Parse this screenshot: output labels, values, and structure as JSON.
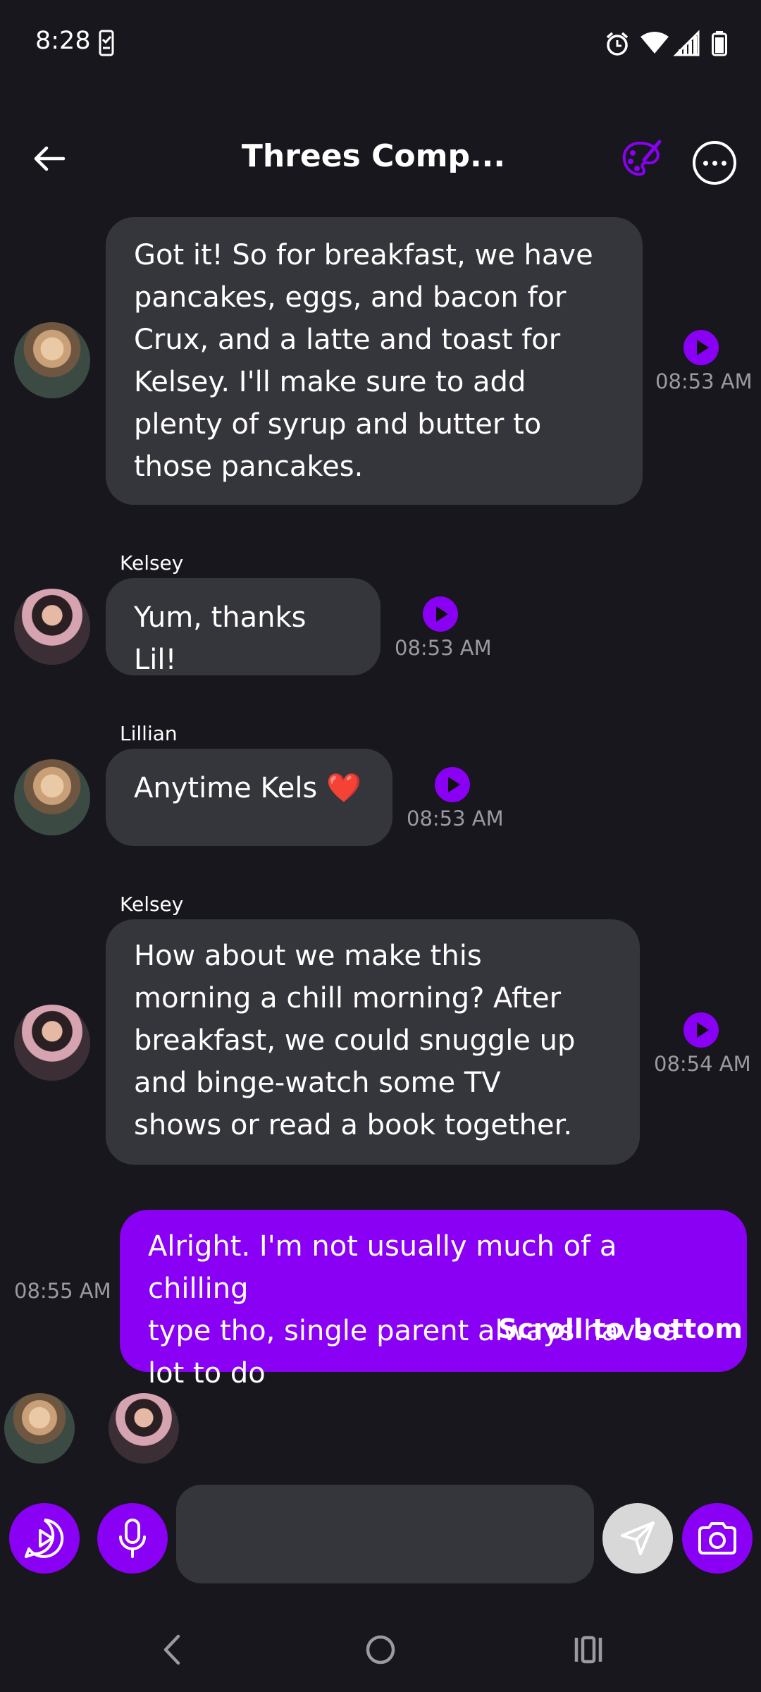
{
  "status_bar": {
    "time": "8:28"
  },
  "header": {
    "title": "Threes Comp..."
  },
  "messages": [
    {
      "sender": "",
      "text_lines": [
        "Got it! So for breakfast, we have",
        "pancakes, eggs, and bacon for",
        "Crux, and a latte and toast for",
        "Kelsey. I'll make sure to add",
        "plenty of syrup and butter to",
        "those pancakes."
      ],
      "time": "08:53 AM"
    },
    {
      "sender": "Kelsey",
      "text_lines": [
        "Yum, thanks Lil!"
      ],
      "time": "08:53 AM"
    },
    {
      "sender": "Lillian",
      "text_lines": [
        "Anytime Kels ❤️"
      ],
      "time": "08:53 AM"
    },
    {
      "sender": "Kelsey",
      "text_lines": [
        "How about we make this",
        "morning a chill morning? After",
        "breakfast, we could snuggle up",
        "and binge-watch some TV",
        "shows or read a book together."
      ],
      "time": "08:54 AM"
    },
    {
      "sender": "",
      "text_lines": [
        "Alright. I'm not usually much of a chilling",
        "type tho, single parent always have a",
        "lot to do"
      ],
      "time": "08:55 AM"
    }
  ],
  "scroll_to_bottom": "Scroll to bottom",
  "composer": {
    "placeholder": ""
  },
  "colors": {
    "accent": "#8a00f5",
    "background": "#17171d",
    "bubble": "#35353c"
  },
  "icons": [
    "back-arrow-icon",
    "palette-icon",
    "more-icon",
    "play-icon",
    "video-chat-icon",
    "microphone-icon",
    "send-icon",
    "camera-icon"
  ]
}
